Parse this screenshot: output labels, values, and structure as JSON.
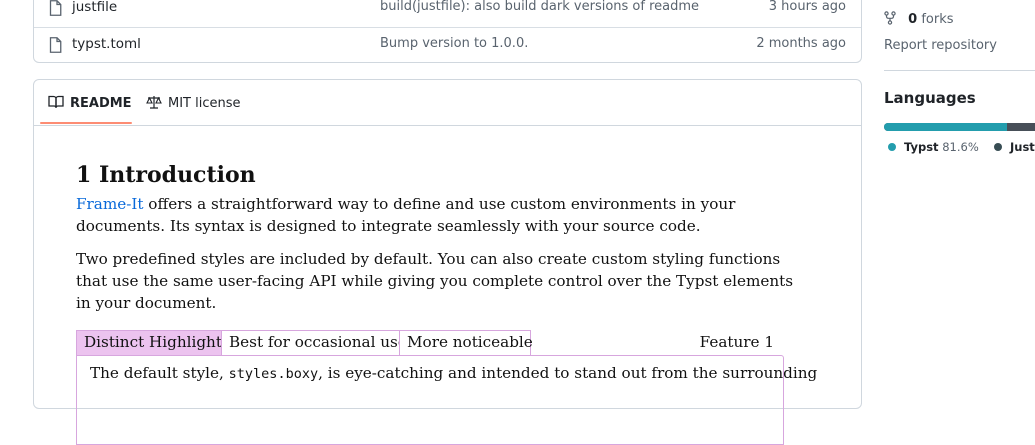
{
  "files": [
    {
      "name": "justfile",
      "icon": "file-icon",
      "message": "build(justfile): also build dark versions of readme",
      "time": "3 hours ago"
    },
    {
      "name": "typst.toml",
      "icon": "file-icon",
      "message": "Bump version to 1.0.0.",
      "time": "2 months ago"
    }
  ],
  "readme": {
    "tabs": [
      {
        "label": "README",
        "icon": "book-icon",
        "active": true
      },
      {
        "label": "MIT license",
        "icon": "law-icon",
        "active": false
      }
    ],
    "heading": "1 Introduction",
    "p1_link": "Frame-It",
    "p1_rest": " offers a straightforward way to define and use custom environments in your documents. Its syntax is designed to integrate seamlessly with your source code.",
    "p2": "Two predefined styles are included by default. You can also create custom styling functions that use the same user-facing API while giving you complete control over the Typst elements in your document.",
    "feature": {
      "tags": [
        "Distinct Highlight",
        "Best for occasional use",
        "More noticeable"
      ],
      "title": "Feature 1",
      "text_before": "The default style, ",
      "code": "styles.boxy",
      "text_after": ", is eye-catching and intended to stand out from the surrounding"
    }
  },
  "sidebar": {
    "forks_count": "0",
    "forks_label": " forks",
    "report": "Report repository",
    "languages_heading": "Languages",
    "languages": [
      {
        "name": "Typst",
        "percent": "81.6%",
        "color": "#239dad"
      },
      {
        "name": "Just",
        "percent": "",
        "color": "#384d54"
      }
    ]
  },
  "colors": {
    "accent_link": "#0969da",
    "tab_underline": "#fd8c73",
    "feature_border": "#d7a6de",
    "feature_fill": "#ecc3ef"
  }
}
